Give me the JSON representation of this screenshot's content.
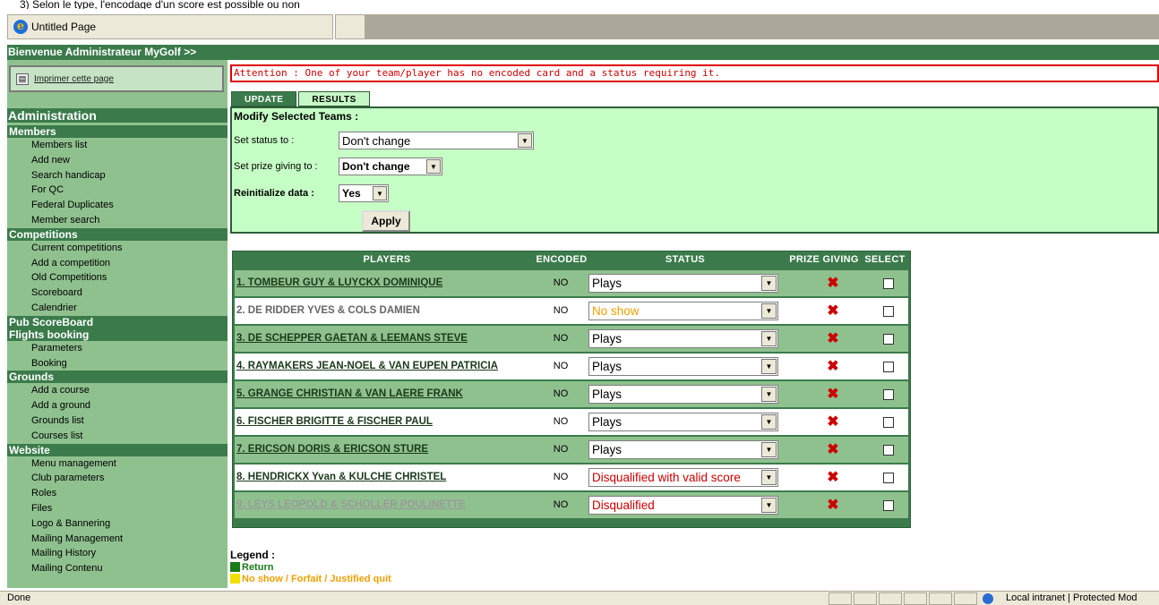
{
  "top_note": "3)    Selon le type, l'encodage d'un score est possible ou non",
  "browser": {
    "tab_title": "Untitled Page"
  },
  "welcome": "Bienvenue Administrateur MyGolf >>",
  "sidebar": {
    "print_label": "Imprimer cette page",
    "admin_title": "Administration",
    "sections": [
      {
        "title": "Members",
        "items": [
          "Members list",
          "Add new",
          "Search handicap",
          "For QC",
          "Federal Duplicates",
          "Member search"
        ]
      },
      {
        "title": "Competitions",
        "items": [
          "Current competitions",
          "Add a competition",
          "Old Competitions",
          "Scoreboard",
          "Calendrier"
        ]
      },
      {
        "title": "Pub ScoreBoard",
        "items": []
      },
      {
        "title": "Flights booking",
        "items": [
          "Parameters",
          "Booking"
        ]
      },
      {
        "title": "Grounds",
        "items": [
          "Add a course",
          "Add a ground",
          "Grounds list",
          "Courses list"
        ]
      },
      {
        "title": "Website",
        "items": [
          "Menu management",
          "Club parameters",
          "Roles",
          "Files",
          "Logo & Bannering",
          "Mailing Management",
          "Mailing History",
          "Mailing Contenu"
        ]
      }
    ]
  },
  "alert": "Attention : One of your team/player has no encoded card and a status requiring it.",
  "tabs": {
    "update": "Update",
    "results": "Results"
  },
  "form": {
    "title": "Modify Selected Teams :",
    "status_label": "Set status to :",
    "status_value": "Don't change",
    "prize_label": "Set prize giving to :",
    "prize_value": "Don't change",
    "reinit_label": "Reinitialize data :",
    "reinit_value": "Yes",
    "apply": "Apply"
  },
  "table": {
    "headers": {
      "players": "Players",
      "encoded": "Encoded",
      "status": "Status",
      "prize": "Prize Giving",
      "select": "Select"
    },
    "rows": [
      {
        "name": "1. TOMBEUR GUY & LUYCKX DOMINIQUE",
        "encoded": "NO",
        "status": "Plays",
        "status_color": "#000000"
      },
      {
        "name": "2. DE RIDDER YVES & COLS DAMIEN",
        "encoded": "NO",
        "status": "No show",
        "status_color": "#f0a000"
      },
      {
        "name": "3. DE SCHEPPER GAETAN & LEEMANS STEVE",
        "encoded": "NO",
        "status": "Plays",
        "status_color": "#000000"
      },
      {
        "name": "4. RAYMAKERS JEAN-NOEL & VAN EUPEN PATRICIA",
        "encoded": "NO",
        "status": "Plays",
        "status_color": "#000000"
      },
      {
        "name": "5. GRANGE CHRISTIAN & VAN LAERE FRANK",
        "encoded": "NO",
        "status": "Plays",
        "status_color": "#000000"
      },
      {
        "name": "6. FISCHER BRIGITTE & FISCHER PAUL",
        "encoded": "NO",
        "status": "Plays",
        "status_color": "#000000"
      },
      {
        "name": "7. ERICSON DORIS & ERICSON STURE",
        "encoded": "NO",
        "status": "Plays",
        "status_color": "#000000"
      },
      {
        "name": "8. HENDRICKX Yvan & KULCHE CHRISTEL",
        "encoded": "NO",
        "status": "Disqualified with valid score",
        "status_color": "#cc0000"
      },
      {
        "name": "9. LEYS LEOPOLD & SCHOLLER POULINETTE",
        "encoded": "NO",
        "status": "Disqualified",
        "status_color": "#cc0000"
      }
    ],
    "prize_icon": "✖"
  },
  "legend": {
    "title": "Legend :",
    "items": [
      {
        "label": "Return",
        "color": "#1a7a1a"
      },
      {
        "label": "No show / Forfait / Justified quit",
        "color": "#f0a000"
      }
    ]
  },
  "statusbar": {
    "done": "Done",
    "zone": "Local intranet | Protected Mod"
  },
  "colors": {
    "dark_green": "#3b7b4b",
    "light_green": "#8fc18f",
    "form_green": "#c6ffc6",
    "alert_red": "#e00000"
  }
}
